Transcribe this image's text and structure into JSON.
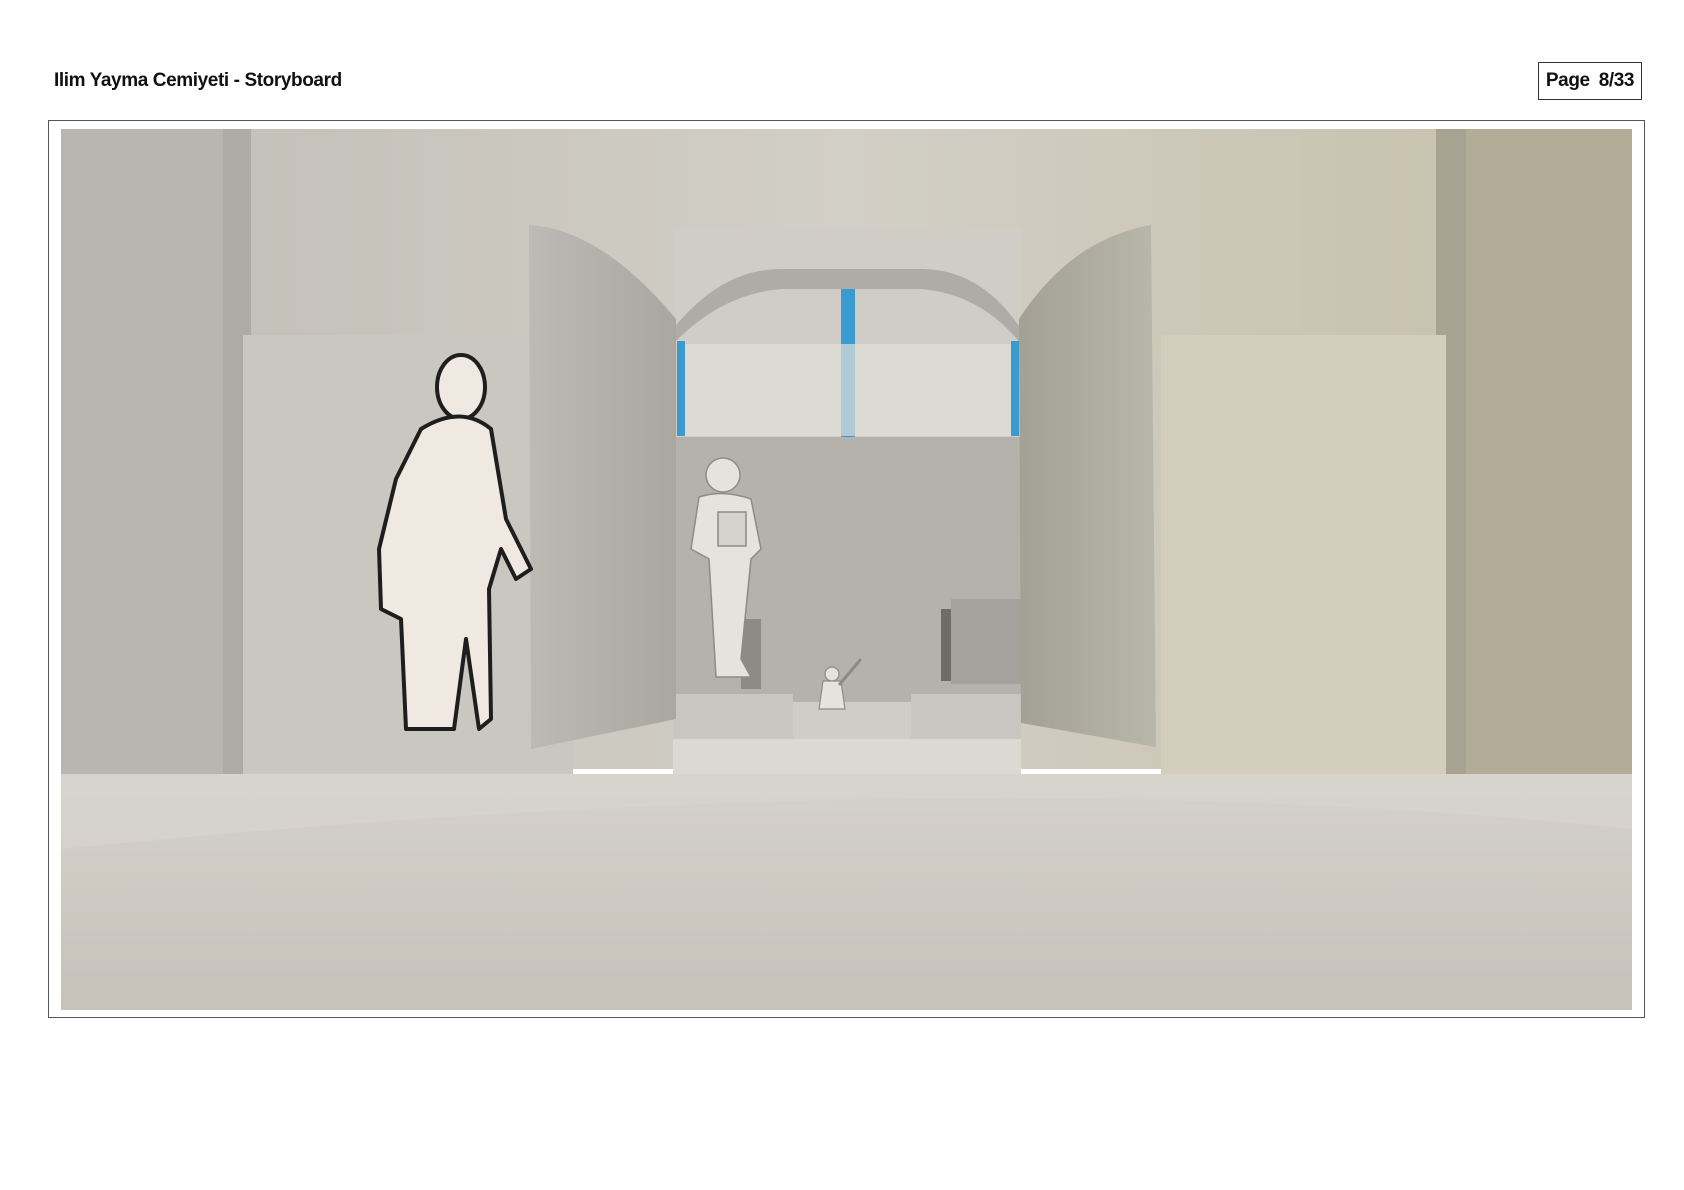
{
  "document": {
    "title": "Ilim Yayma Cemiyeti - Storyboard",
    "page_label": "Page",
    "page_number": "8/33"
  },
  "panel": {
    "colors": {
      "wall_left": "#bdbab3",
      "wall_right": "#c9c3ae",
      "floor": "#cbc8c1",
      "door": "#a9a79f",
      "window_frame": "#3a9bd0"
    }
  }
}
